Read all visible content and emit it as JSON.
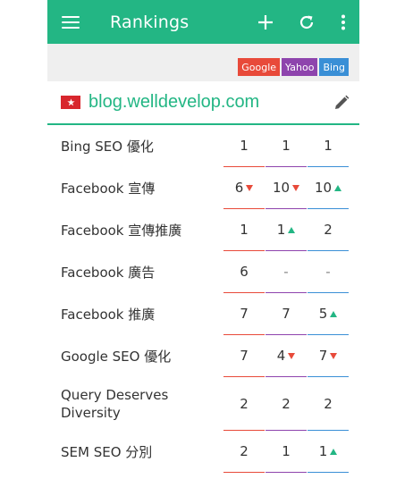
{
  "appbar": {
    "title": "Rankings"
  },
  "engines": [
    {
      "label": "Google",
      "color": "#e84a3a"
    },
    {
      "label": "Yahoo",
      "color": "#8e44ad"
    },
    {
      "label": "Bing",
      "color": "#3a8fd6"
    }
  ],
  "domain": {
    "url": "blog.welldevelop.com",
    "flag": "hong-kong-flag"
  },
  "colors": {
    "accent": "#23b684",
    "google": "#e84a3a",
    "yahoo": "#8e44ad",
    "bing": "#3a8fd6",
    "up": "#23b684",
    "down": "#e84a3a"
  },
  "keywords": [
    {
      "keyword": "Bing SEO 優化",
      "google": {
        "rank": "1",
        "trend": ""
      },
      "yahoo": {
        "rank": "1",
        "trend": ""
      },
      "bing": {
        "rank": "1",
        "trend": ""
      }
    },
    {
      "keyword": "Facebook 宣傳",
      "google": {
        "rank": "6",
        "trend": "down"
      },
      "yahoo": {
        "rank": "10",
        "trend": "down"
      },
      "bing": {
        "rank": "10",
        "trend": "up"
      }
    },
    {
      "keyword": "Facebook 宣傳推廣",
      "google": {
        "rank": "1",
        "trend": ""
      },
      "yahoo": {
        "rank": "1",
        "trend": "up"
      },
      "bing": {
        "rank": "2",
        "trend": ""
      }
    },
    {
      "keyword": "Facebook 廣告",
      "google": {
        "rank": "6",
        "trend": ""
      },
      "yahoo": {
        "rank": "-",
        "trend": ""
      },
      "bing": {
        "rank": "-",
        "trend": ""
      }
    },
    {
      "keyword": "Facebook 推廣",
      "google": {
        "rank": "7",
        "trend": ""
      },
      "yahoo": {
        "rank": "7",
        "trend": ""
      },
      "bing": {
        "rank": "5",
        "trend": "up"
      }
    },
    {
      "keyword": "Google SEO 優化",
      "google": {
        "rank": "7",
        "trend": ""
      },
      "yahoo": {
        "rank": "4",
        "trend": "down"
      },
      "bing": {
        "rank": "7",
        "trend": "down"
      }
    },
    {
      "keyword": "Query Deserves Diversity",
      "google": {
        "rank": "2",
        "trend": ""
      },
      "yahoo": {
        "rank": "2",
        "trend": ""
      },
      "bing": {
        "rank": "2",
        "trend": ""
      }
    },
    {
      "keyword": "SEM SEO 分別",
      "google": {
        "rank": "2",
        "trend": ""
      },
      "yahoo": {
        "rank": "1",
        "trend": ""
      },
      "bing": {
        "rank": "1",
        "trend": "up"
      }
    }
  ]
}
